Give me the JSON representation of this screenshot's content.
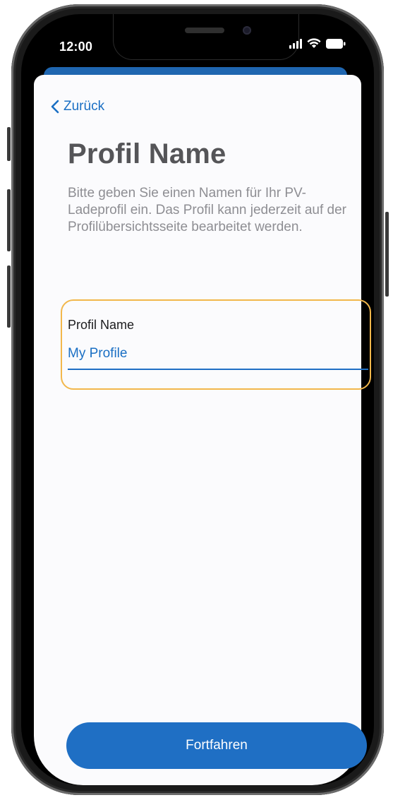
{
  "status_bar": {
    "time": "12:00",
    "icons": [
      "signal-icon",
      "wifi-icon",
      "battery-icon"
    ]
  },
  "navigation": {
    "back_label": "Zurück",
    "back_icon": "chevron-left-icon"
  },
  "page": {
    "title": "Profil Name",
    "description": "Bitte geben Sie einen Namen für Ihr PV-Ladeprofil ein. Das Profil kann jederzeit auf der Profilübersichtsseite bearbeitet werden."
  },
  "form": {
    "field_label": "Profil Name",
    "field_value": "My Profile"
  },
  "actions": {
    "continue_label": "Fortfahren"
  },
  "colors": {
    "accent": "#1f6fc4",
    "highlight": "#f2b74b",
    "title": "#555558",
    "description": "#8e8e93"
  }
}
